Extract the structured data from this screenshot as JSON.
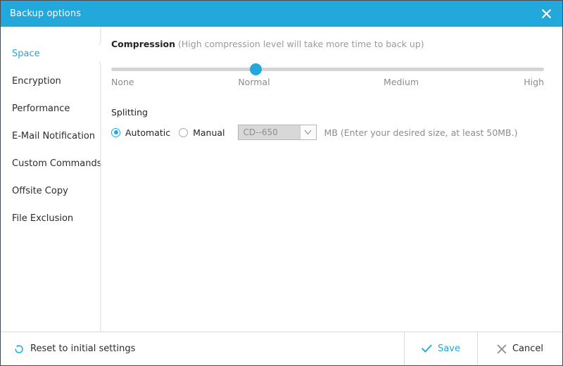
{
  "window": {
    "title": "Backup options",
    "accent_color": "#22a8da",
    "titlebar_text_color": "#ffffff",
    "close_icon": "close-icon"
  },
  "sidebar": {
    "items": [
      {
        "label": "Space",
        "active": true
      },
      {
        "label": "Encryption",
        "active": false
      },
      {
        "label": "Performance",
        "active": false
      },
      {
        "label": "E-Mail Notification",
        "active": false
      },
      {
        "label": "Custom Commands",
        "active": false
      },
      {
        "label": "Offsite Copy",
        "active": false
      },
      {
        "label": "File Exclusion",
        "active": false
      }
    ]
  },
  "compression": {
    "label": "Compression",
    "hint": "(High compression level will take more time to back up)",
    "slider": {
      "value_label": "Normal",
      "thumb_percent": 33,
      "ticks": [
        {
          "label": "None",
          "percent": 0,
          "align": "left"
        },
        {
          "label": "Normal",
          "percent": 33,
          "align": "center"
        },
        {
          "label": "Medium",
          "percent": 67,
          "align": "center"
        },
        {
          "label": "High",
          "percent": 100,
          "align": "right"
        }
      ],
      "track_color": "#d4d4d4",
      "thumb_color": "#22a8da"
    }
  },
  "splitting": {
    "title": "Splitting",
    "options": [
      {
        "label": "Automatic",
        "selected": true
      },
      {
        "label": "Manual",
        "selected": false
      }
    ],
    "size_select": {
      "value": "CD--650",
      "disabled": true,
      "arrow_icon": "chevron-down-icon"
    },
    "unit_hint": "MB (Enter your desired size, at least 50MB.)"
  },
  "footer": {
    "reset_label": "Reset to initial settings",
    "reset_icon": "reset-circular-arrow-icon",
    "save_label": "Save",
    "save_icon": "check-icon",
    "cancel_label": "Cancel",
    "cancel_icon": "close-x-icon"
  }
}
